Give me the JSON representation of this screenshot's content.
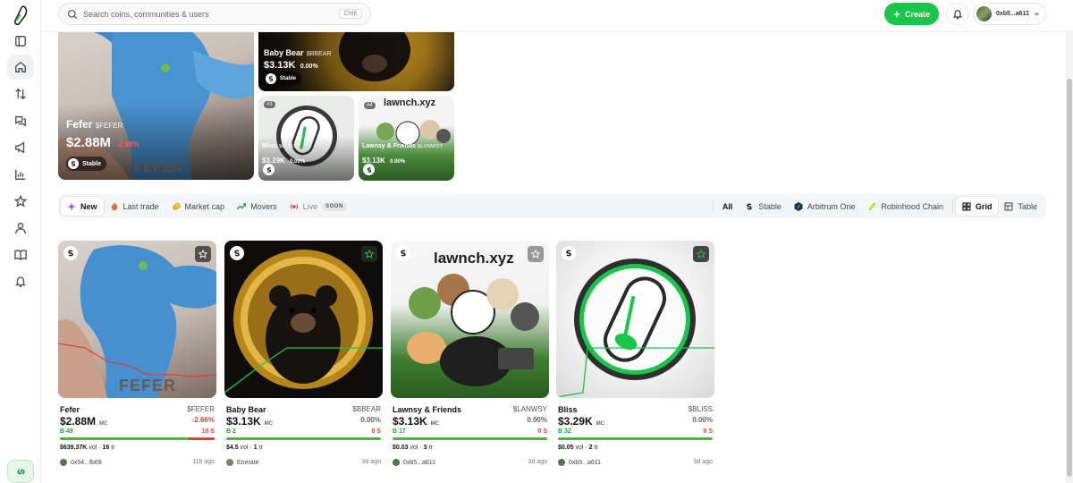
{
  "search": {
    "placeholder": "Search coins, communities & users",
    "shortcut": "CtrlK"
  },
  "header": {
    "create_label": "Create",
    "account_label": "0xb5...a611"
  },
  "featured": [
    {
      "name": "Fefer",
      "ticker": "$FEFER",
      "mc": "$2.88M",
      "change": "-2.66%",
      "chip": "Stable",
      "rank": "",
      "art_text": "FEFER"
    },
    {
      "name": "Baby Bear",
      "ticker": "$BBEAR",
      "mc": "$3.13K",
      "change": "0.00%",
      "chip": "Stable",
      "rank": ""
    },
    {
      "name": "Bliss",
      "ticker": "$BLISS",
      "mc": "$3.29K",
      "change": "0.00%",
      "rank": "#3"
    },
    {
      "name": "Lawnsy & Friends",
      "ticker": "$LANWSY",
      "mc": "$3.13K",
      "change": "0.00%",
      "rank": "#4",
      "art_text": "lawnch.xyz"
    }
  ],
  "filters": {
    "left": [
      {
        "label": "New",
        "icon": "sparkle-icon"
      },
      {
        "label": "Last trade",
        "icon": "flame-icon"
      },
      {
        "label": "Market cap",
        "icon": "coins-icon"
      },
      {
        "label": "Movers",
        "icon": "trend-icon"
      },
      {
        "label": "Live",
        "icon": "broadcast-icon",
        "badge": "SOON"
      }
    ],
    "right": [
      {
        "label": "All"
      },
      {
        "label": "Stable",
        "icon": "stable-icon"
      },
      {
        "label": "Arbitrum One",
        "icon": "arbitrum-icon"
      },
      {
        "label": "Robinhood Chain",
        "icon": "robinhood-icon"
      },
      {
        "label": "Grid",
        "icon": "grid-icon"
      },
      {
        "label": "Table",
        "icon": "table-icon"
      }
    ]
  },
  "cards": [
    {
      "name": "Fefer",
      "ticker": "$FEFER",
      "mc": "$2.88M",
      "mc_label": "MC",
      "change": "-2.66%",
      "buys": "B 49",
      "sells": "10 S",
      "buy_ratio": 0.83,
      "vol": "$639.37K",
      "vol_label": "vol",
      "trades": "16",
      "trades_label": "tr",
      "user": "0x54...fb69",
      "age": "11h ago",
      "art_text": "FEFER"
    },
    {
      "name": "Baby Bear",
      "ticker": "$BBEAR",
      "mc": "$3.13K",
      "mc_label": "MC",
      "change": "0.00%",
      "buys": "B 2",
      "sells": "0 S",
      "buy_ratio": 1.0,
      "vol": "$4.5",
      "vol_label": "vol",
      "trades": "1",
      "trades_label": "tr",
      "user": "Enerate",
      "age": "3d ago"
    },
    {
      "name": "Lawnsy & Friends",
      "ticker": "$LANWSY",
      "mc": "$3.13K",
      "mc_label": "MC",
      "change": "0.00%",
      "buys": "B 17",
      "sells": "0 S",
      "buy_ratio": 1.0,
      "vol": "$0.03",
      "vol_label": "vol",
      "trades": "3",
      "trades_label": "tr",
      "user": "0xb5...a611",
      "age": "3d ago",
      "art_text": "lawnch.xyz"
    },
    {
      "name": "Bliss",
      "ticker": "$BLISS",
      "mc": "$3.29K",
      "mc_label": "MC",
      "change": "0.00%",
      "buys": "B 32",
      "sells": "0 S",
      "buy_ratio": 1.0,
      "vol": "$0.05",
      "vol_label": "vol",
      "trades": "2",
      "trades_label": "tr",
      "user": "0xb5...a611",
      "age": "5d ago"
    }
  ],
  "colors": {
    "accent": "#19c64a",
    "buy": "#4fb33e",
    "sell": "#e0403a"
  }
}
